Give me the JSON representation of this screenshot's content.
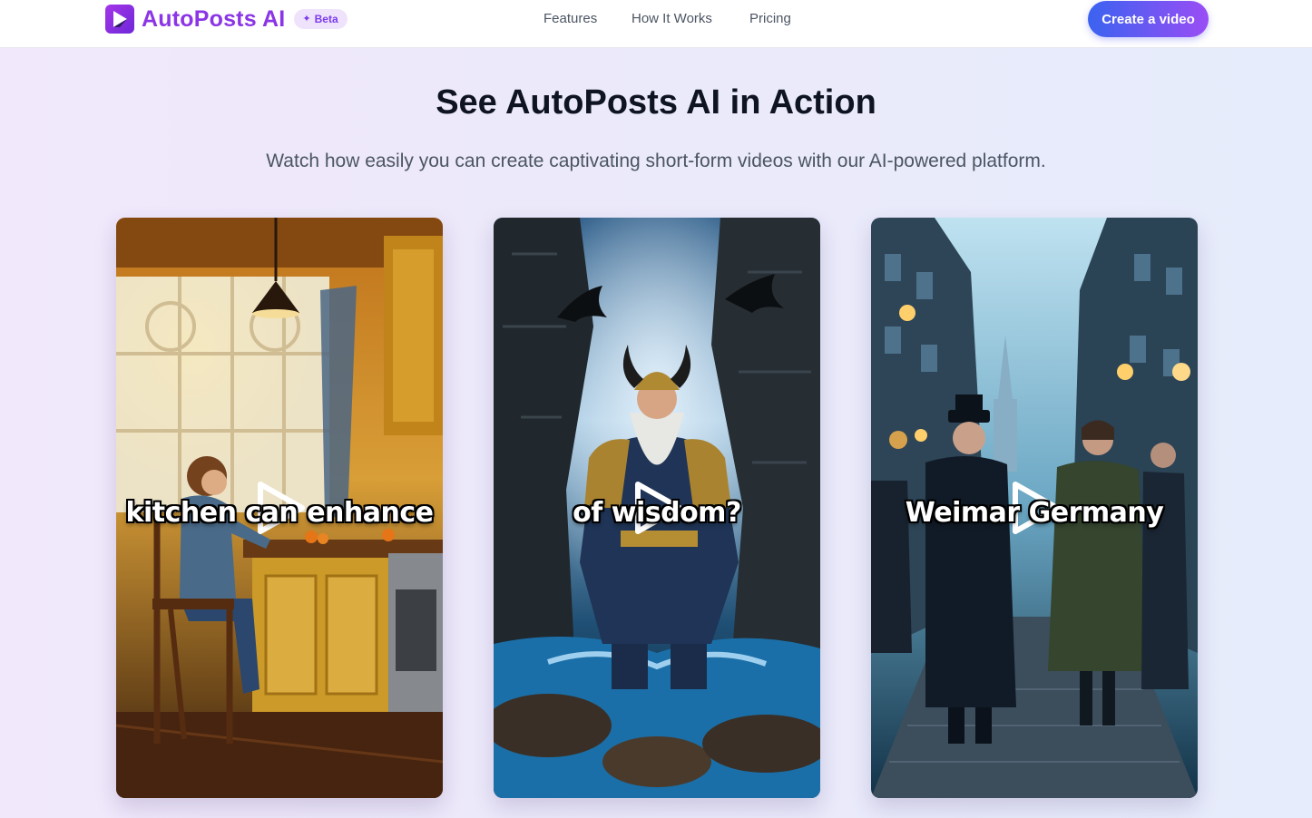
{
  "brand": {
    "name": "AutoPosts AI",
    "badge": "Beta",
    "logo_icon": "play-logo-icon",
    "colors": {
      "brand": "#8b35e6",
      "badge_bg": "#efe3fb"
    }
  },
  "nav": {
    "links": [
      "Features",
      "How It Works",
      "Pricing"
    ],
    "cta_label": "Create a video",
    "cta_gradient": [
      "#3b63f0",
      "#9a4df5"
    ]
  },
  "section": {
    "title": "See AutoPosts AI in Action",
    "subtitle": "Watch how easily you can create captivating short-form videos with our AI-powered platform."
  },
  "videos": [
    {
      "caption": "kitchen can enhance",
      "scene": "girl sitting at kitchen window, warm sunlight",
      "icon": "play-icon"
    },
    {
      "caption": "of wisdom?",
      "scene": "armored viking with horned helmet in stormy water with ravens",
      "icon": "play-icon"
    },
    {
      "caption": "Weimar Germany",
      "scene": "people in 1920s coats on lantern-lit cobblestone street",
      "icon": "play-icon"
    }
  ]
}
